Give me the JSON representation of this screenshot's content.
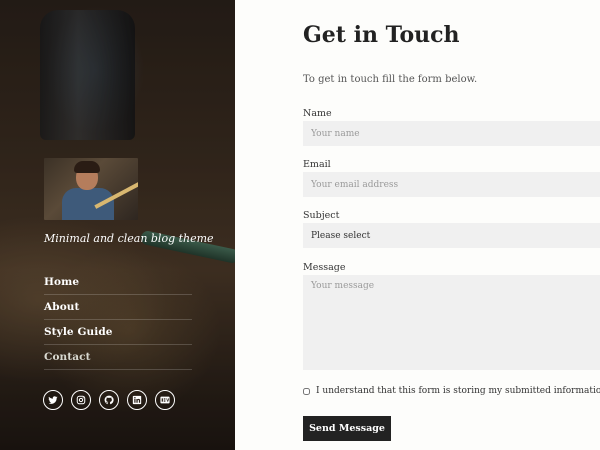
{
  "sidebar": {
    "tagline": "Minimal and clean blog theme",
    "nav": [
      {
        "label": "Home"
      },
      {
        "label": "About"
      },
      {
        "label": "Style Guide"
      },
      {
        "label": "Contact",
        "current": true
      }
    ],
    "social": [
      "twitter-icon",
      "instagram-icon",
      "github-icon",
      "linkedin-icon",
      "dev-icon"
    ]
  },
  "main": {
    "title": "Get in Touch",
    "intro": "To get in touch fill the form below.",
    "form": {
      "name_label": "Name",
      "name_placeholder": "Your name",
      "email_label": "Email",
      "email_placeholder": "Your email address",
      "subject_label": "Subject",
      "subject_value": "Please select",
      "message_label": "Message",
      "message_placeholder": "Your message",
      "consent_text": "I understand that this form is storing my submitted information so I can be c",
      "submit_label": "Send Message"
    }
  },
  "colors": {
    "button": "#222222",
    "field_bg": "#f0f0f0",
    "page_bg": "#fdfdfb"
  }
}
